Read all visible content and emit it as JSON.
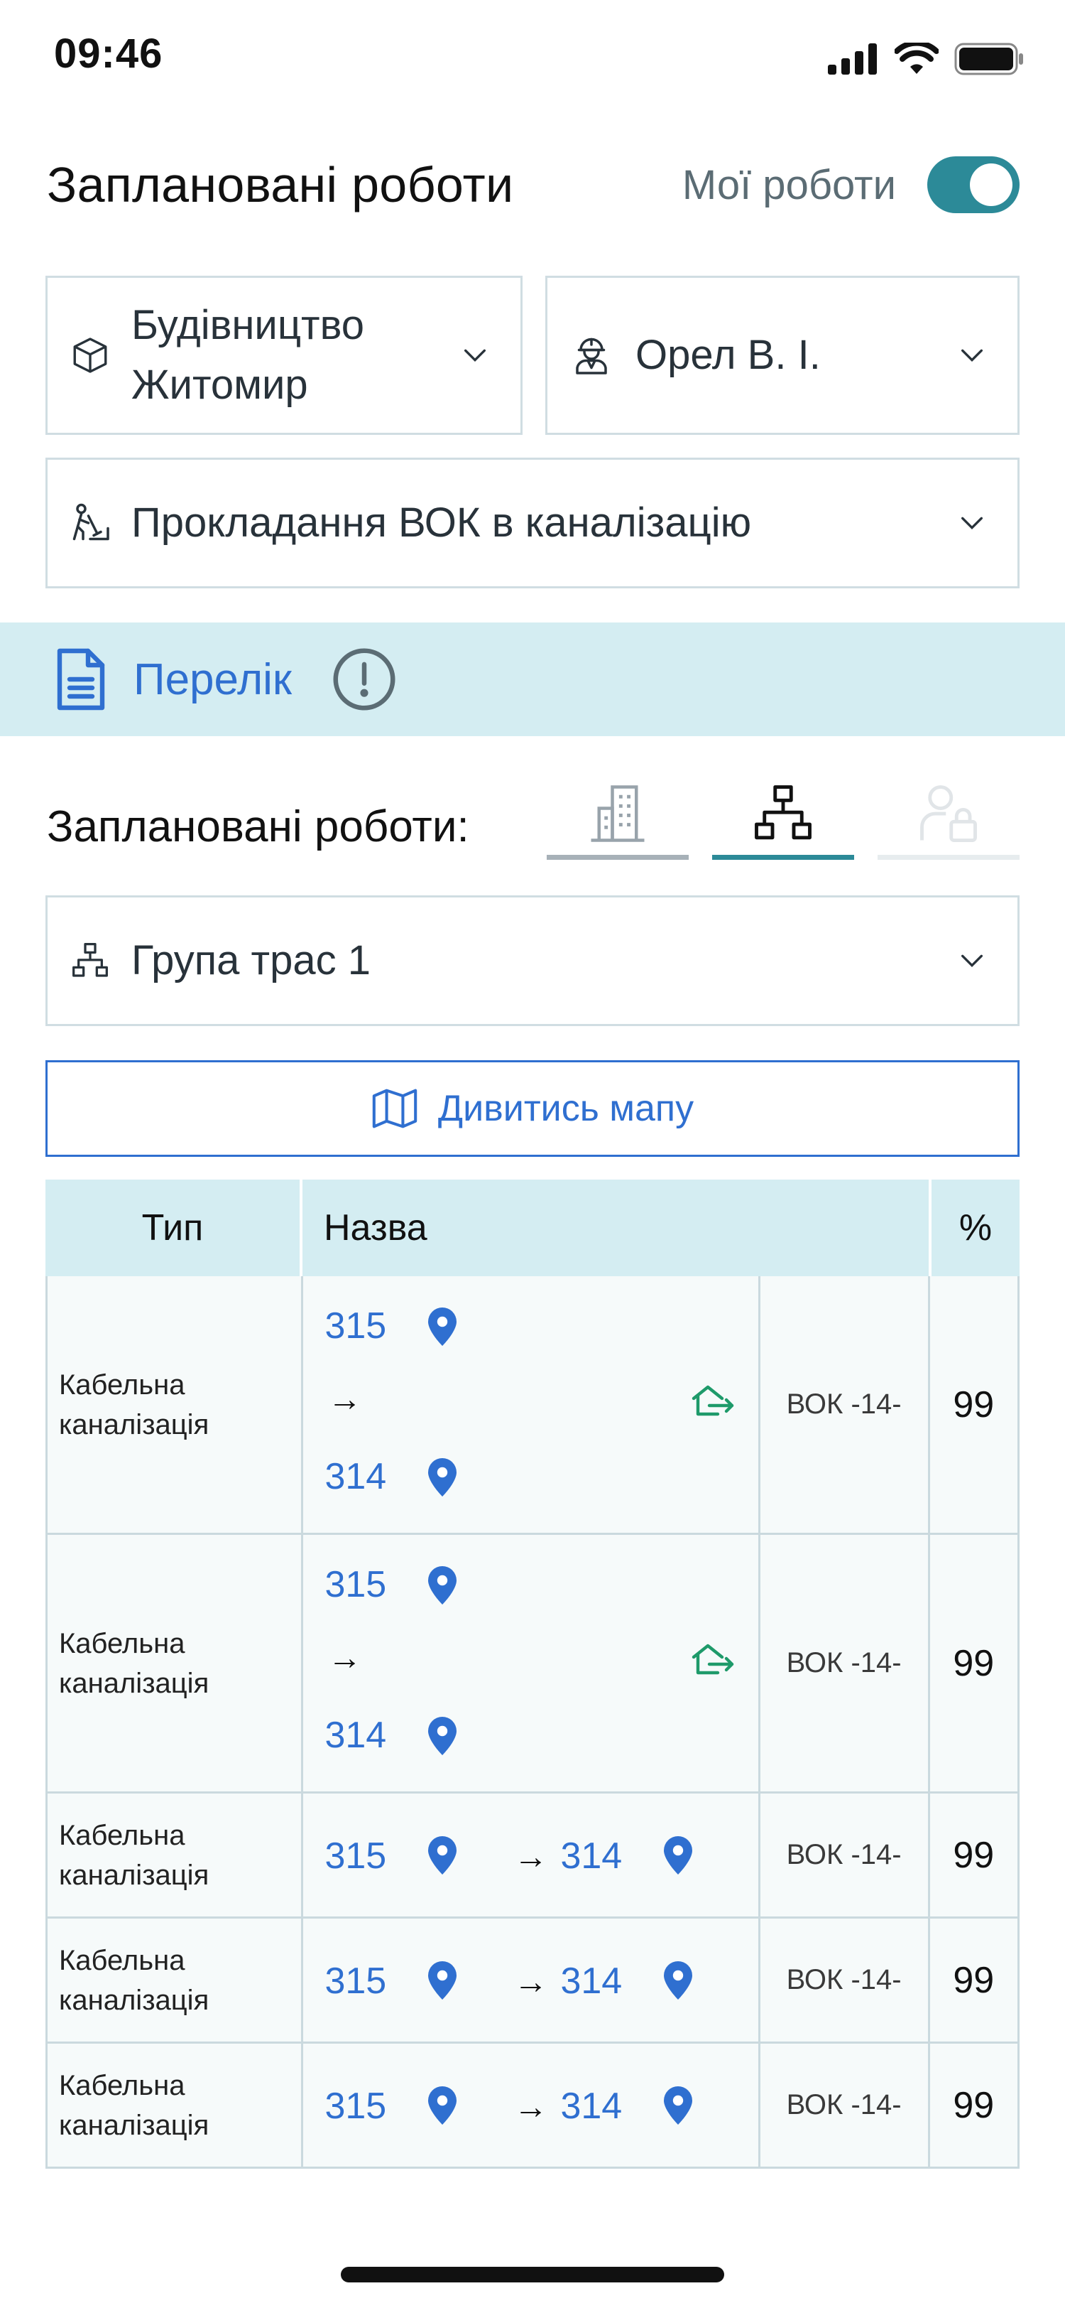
{
  "status_bar": {
    "time": "09:46"
  },
  "header": {
    "title": "Заплановані роботи",
    "toggle_label": "Мої роботи",
    "toggle_on": true
  },
  "filters": {
    "project": {
      "line1": "Будівництво",
      "line2": "Житомир",
      "icon": "cube-icon"
    },
    "employee": {
      "value": "Орел В. І.",
      "icon": "worker-icon"
    },
    "work_type": {
      "value": "Прокладання ВОК в каналізацію",
      "icon": "digging-worker-icon"
    }
  },
  "list_band": {
    "label": "Перелік"
  },
  "planned": {
    "label": "Заплановані роботи:",
    "tabs": [
      {
        "name": "building",
        "active": false
      },
      {
        "name": "network",
        "active": true
      },
      {
        "name": "user",
        "active": false
      }
    ]
  },
  "group": {
    "value": "Група трас 1"
  },
  "map_button": {
    "label": "Дивитись мапу"
  },
  "table": {
    "headers": {
      "type": "Тип",
      "name": "Назва",
      "pct": "%"
    },
    "rows": [
      {
        "type_line1": "Кабельна",
        "type_line2": "каналізація",
        "from": "315",
        "to": "314",
        "code": "ВОК -14-",
        "pct": "99",
        "layout": "stacked"
      },
      {
        "type_line1": "Кабельна",
        "type_line2": "каналізація",
        "from": "315",
        "to": "314",
        "code": "ВОК -14-",
        "pct": "99",
        "layout": "stacked"
      },
      {
        "type_line1": "Кабельна",
        "type_line2": "каналізація",
        "from": "315",
        "to": "314",
        "code": "ВОК -14-",
        "pct": "99",
        "layout": "inline"
      },
      {
        "type_line1": "Кабельна",
        "type_line2": "каналізація",
        "from": "315",
        "to": "314",
        "code": "ВОК -14-",
        "pct": "99",
        "layout": "inline"
      },
      {
        "type_line1": "Кабельна",
        "type_line2": "каналізація",
        "from": "315",
        "to": "314",
        "code": "ВОК -14-",
        "pct": "99",
        "layout": "inline"
      }
    ]
  },
  "colors": {
    "accent": "#2f6fd0",
    "toggle": "#2c8a98",
    "band": "#d4edf2",
    "house_icon": "#1e9a6a"
  }
}
